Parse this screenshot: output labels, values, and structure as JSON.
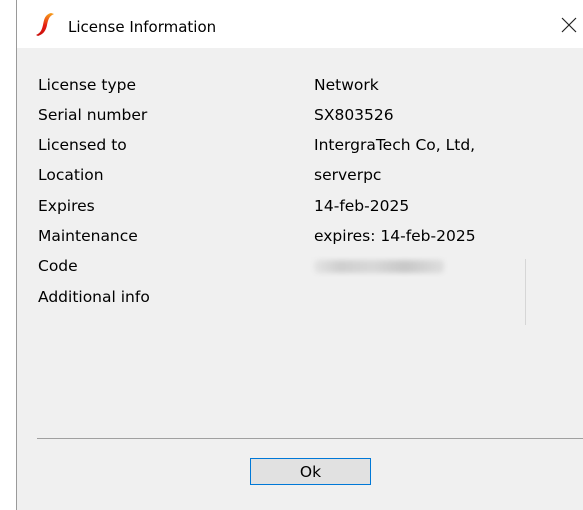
{
  "window": {
    "title": "License Information",
    "close_icon": "close-icon",
    "app_icon": "app-logo-icon"
  },
  "license": {
    "rows": [
      {
        "label": "License type",
        "value": "Network"
      },
      {
        "label": "Serial number",
        "value": "SX803526"
      },
      {
        "label": "Licensed to",
        "value": "IntergraTech Co, Ltd,"
      },
      {
        "label": "Location",
        "value": "serverpc"
      },
      {
        "label": "Expires",
        "value": "14-feb-2025"
      },
      {
        "label": "Maintenance",
        "value": "expires: 14-feb-2025"
      },
      {
        "label": "Code",
        "value": ""
      },
      {
        "label": "Additional info",
        "value": ""
      }
    ]
  },
  "buttons": {
    "ok_label": "Ok"
  },
  "colors": {
    "dialog_bg": "#f0f0f0",
    "titlebar_bg": "#ffffff",
    "button_focus_border": "#0078d7",
    "logo_red": "#e41b13",
    "logo_orange": "#f7a21b"
  }
}
